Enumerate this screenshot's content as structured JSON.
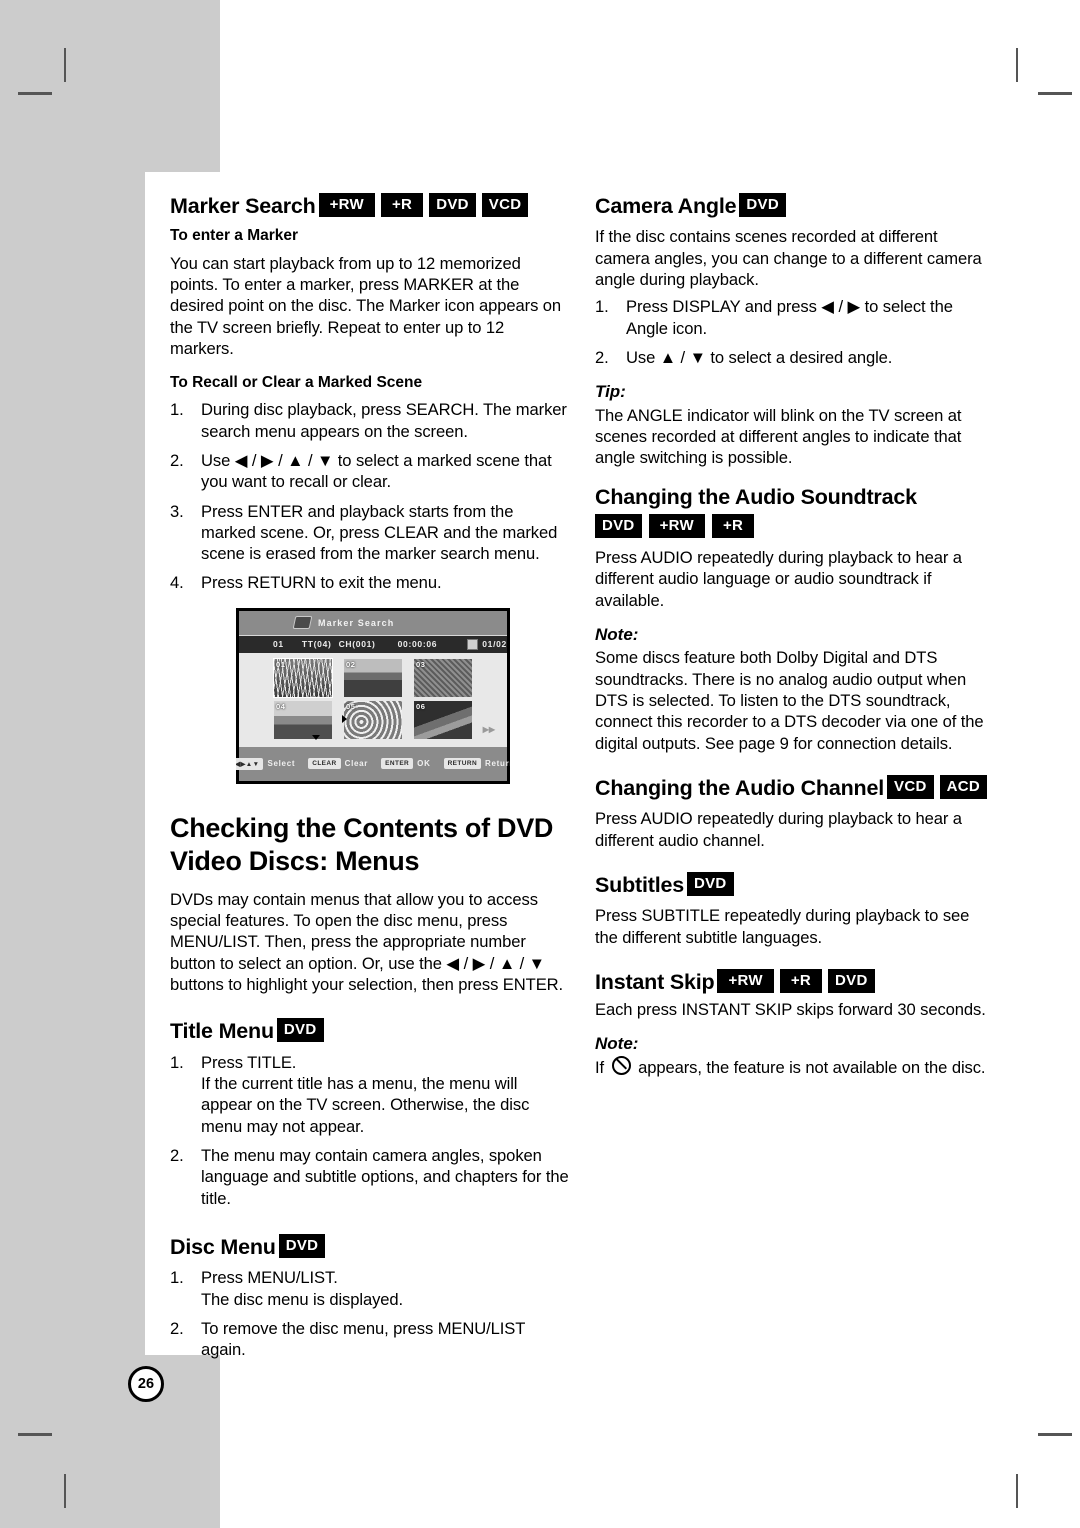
{
  "page": {
    "number": "26",
    "background_gray": "#cccccc"
  },
  "left_column": {
    "marker_search": {
      "title": "Marker Search",
      "badges": [
        "+RW",
        "+R",
        "DVD",
        "VCD"
      ],
      "enter_marker": {
        "subheading": "To enter a Marker",
        "body": "You can start playback from up to 12 memorized points. To enter a marker, press MARKER at the desired point on the disc. The Marker icon appears on the TV screen briefly. Repeat to enter up to 12 markers."
      },
      "recall_clear": {
        "subheading": "To Recall or Clear a Marked Scene",
        "steps": [
          "During disc playback, press SEARCH. The marker search menu appears on the screen.",
          "Use ◀ / ▶ / ▲ / ▼ to select a marked scene that you want to recall or clear.",
          "Press ENTER and playback starts from the marked scene. Or, press CLEAR and the marked scene is erased from the marker search menu.",
          "Press RETURN to exit the menu."
        ]
      }
    },
    "osd_screenshot": {
      "window_title": "Marker Search",
      "status": {
        "marker_no": "01",
        "title": "TT(04)",
        "chapter": "CH(001)",
        "time": "00:00:06",
        "page": "01/02"
      },
      "thumbnails": [
        "01",
        "02",
        "03",
        "04",
        "05",
        "06"
      ],
      "actions": [
        {
          "key": "◀▶▲▼",
          "label": "Select"
        },
        {
          "key": "CLEAR",
          "label": "Clear"
        },
        {
          "key": "ENTER",
          "label": "OK"
        },
        {
          "key": "RETURN",
          "label": "Return"
        }
      ]
    },
    "menus_section": {
      "title": "Checking the Contents of DVD Video Discs: Menus",
      "body": "DVDs may contain menus that allow you to access special features. To open the disc menu, press MENU/LIST. Then, press the appropriate number button to select an option. Or, use the ◀ / ▶ / ▲ / ▼ buttons to highlight your selection, then press ENTER."
    },
    "title_menu": {
      "title": "Title Menu",
      "badges": [
        "DVD"
      ],
      "steps": [
        "Press TITLE.\nIf the current title has a menu, the menu will appear on the TV screen. Otherwise, the disc menu may not appear.",
        "The menu may contain camera angles, spoken language and subtitle options, and chapters for the title."
      ]
    },
    "disc_menu": {
      "title": "Disc Menu",
      "badges": [
        "DVD"
      ],
      "steps": [
        "Press MENU/LIST.\nThe disc menu is displayed.",
        "To remove the disc menu, press MENU/LIST again."
      ]
    }
  },
  "right_column": {
    "camera_angle": {
      "title": "Camera Angle",
      "badges": [
        "DVD"
      ],
      "body": "If the disc contains scenes recorded at different camera angles, you can change to a different camera angle during playback.",
      "steps": [
        "Press DISPLAY and press ◀ / ▶ to select the Angle icon.",
        "Use ▲ / ▼ to select a desired angle."
      ],
      "tip_label": "Tip:",
      "tip_body": "The ANGLE indicator will blink on the TV screen at scenes recorded at different angles to indicate that angle switching is possible."
    },
    "audio_soundtrack": {
      "title": "Changing the Audio Soundtrack",
      "badges": [
        "DVD",
        "+RW",
        "+R"
      ],
      "body": "Press AUDIO repeatedly during playback to hear a different audio language or audio soundtrack if available.",
      "note_label": "Note:",
      "note_body": "Some discs feature both Dolby Digital and DTS soundtracks. There is no analog audio output when DTS is selected. To listen to the DTS soundtrack, connect this recorder to a DTS decoder via one of the digital outputs. See page 9 for connection details."
    },
    "audio_channel": {
      "title": "Changing the Audio Channel",
      "badges": [
        "VCD",
        "ACD"
      ],
      "body": "Press AUDIO repeatedly during playback to hear a different audio channel."
    },
    "subtitles": {
      "title": "Subtitles",
      "badges": [
        "DVD"
      ],
      "body": "Press SUBTITLE repeatedly during playback to see the different subtitle languages."
    },
    "instant_skip": {
      "title": "Instant Skip",
      "badges": [
        "+RW",
        "+R",
        "DVD"
      ],
      "body": "Each press INSTANT SKIP skips forward 30 seconds.",
      "note_label": "Note:",
      "note_prefix": "If",
      "note_suffix": "appears, the feature is not available on the disc."
    }
  }
}
